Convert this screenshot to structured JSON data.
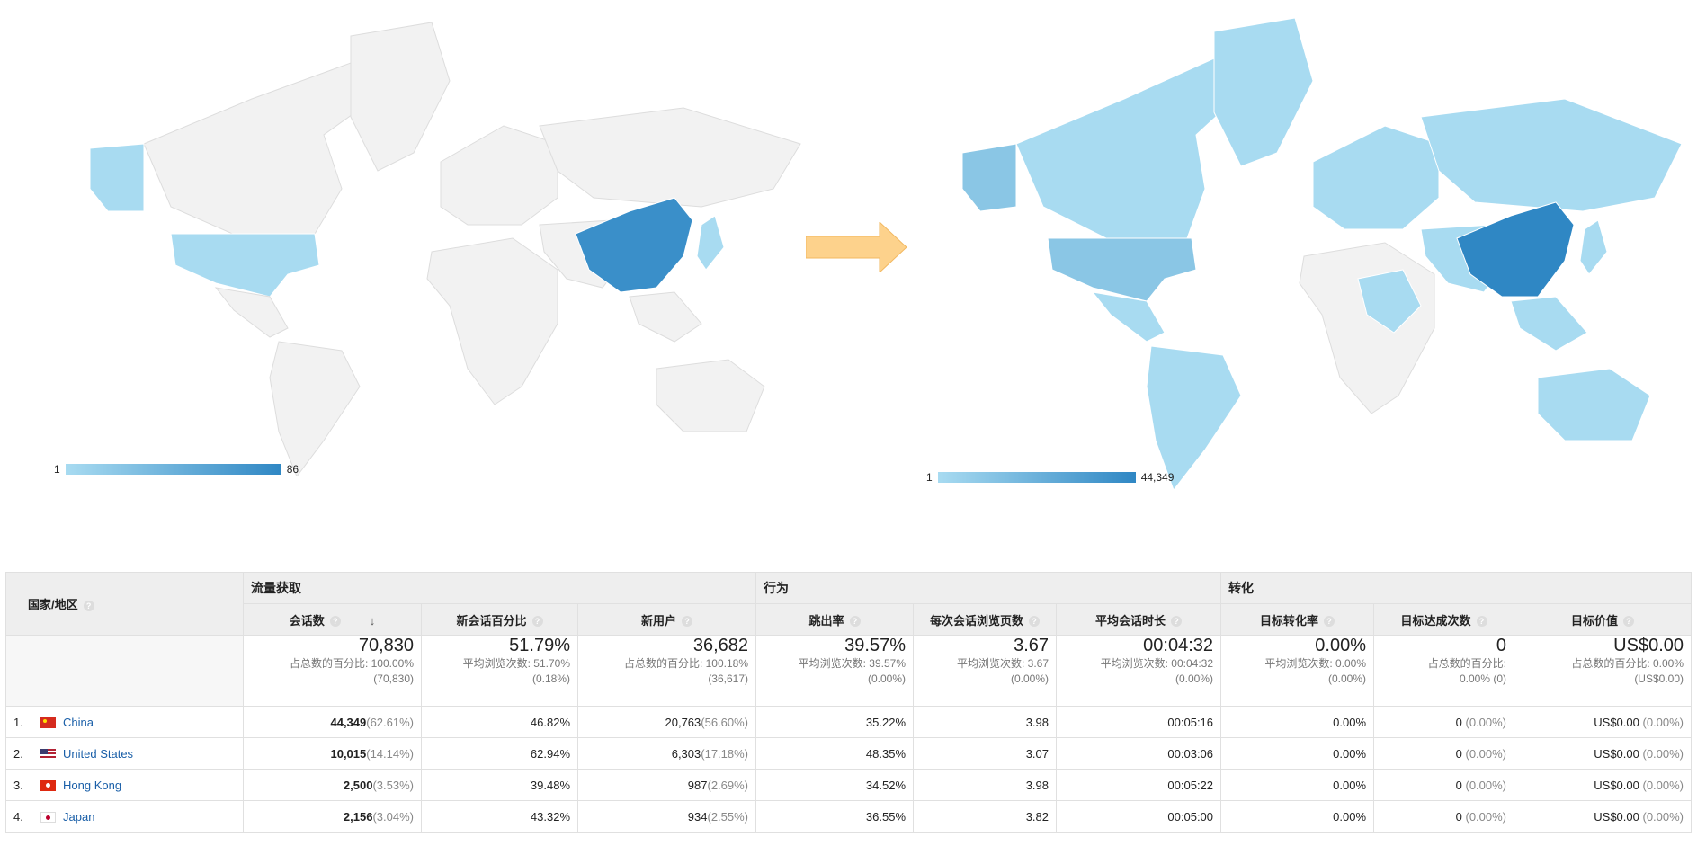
{
  "maps": {
    "left": {
      "legend_min": "1",
      "legend_max": "86"
    },
    "right": {
      "legend_min": "1",
      "legend_max": "44,349"
    }
  },
  "colors": {
    "low": "#a8dbf1",
    "high": "#2f87c4",
    "none": "#f2f2f2",
    "arrow": "#fdd28c"
  },
  "table": {
    "country_header": "国家/地区",
    "groups": {
      "acquisition": "流量获取",
      "behavior": "行为",
      "conversion": "转化"
    },
    "columns": {
      "sessions": "会话数",
      "new_sessions_pct": "新会话百分比",
      "new_users": "新用户",
      "bounce_rate": "跳出率",
      "pages_per_session": "每次会话浏览页数",
      "avg_duration": "平均会话时长",
      "goal_conv_rate": "目标转化率",
      "goal_completions": "目标达成次数",
      "goal_value": "目标价值"
    },
    "totals": {
      "sessions": {
        "big": "70,830",
        "l1": "占总数的百分比: 100.00%",
        "l2": "(70,830)"
      },
      "new_sessions_pct": {
        "big": "51.79%",
        "l1": "平均浏览次数: 51.70%",
        "l2": "(0.18%)"
      },
      "new_users": {
        "big": "36,682",
        "l1": "占总数的百分比: 100.18%",
        "l2": "(36,617)"
      },
      "bounce_rate": {
        "big": "39.57%",
        "l1": "平均浏览次数: 39.57%",
        "l2": "(0.00%)"
      },
      "pages_per_session": {
        "big": "3.67",
        "l1": "平均浏览次数: 3.67",
        "l2": "(0.00%)"
      },
      "avg_duration": {
        "big": "00:04:32",
        "l1": "平均浏览次数: 00:04:32",
        "l2": "(0.00%)"
      },
      "goal_conv_rate": {
        "big": "0.00%",
        "l1": "平均浏览次数: 0.00%",
        "l2": "(0.00%)"
      },
      "goal_completions": {
        "big": "0",
        "l1": "占总数的百分比:",
        "l2": "0.00% (0)"
      },
      "goal_value": {
        "big": "US$0.00",
        "l1": "占总数的百分比: 0.00%",
        "l2": "(US$0.00)"
      }
    },
    "rows": [
      {
        "num": "1.",
        "flag": "cn",
        "country": "China",
        "sessions": "44,349",
        "sessions_pct": "(62.61%)",
        "new_sessions_pct": "46.82%",
        "new_users": "20,763",
        "new_users_pct": "(56.60%)",
        "bounce_rate": "35.22%",
        "pages_per_session": "3.98",
        "avg_duration": "00:05:16",
        "goal_conv_rate": "0.00%",
        "goal_completions": "0",
        "goal_completions_pct": "(0.00%)",
        "goal_value": "US$0.00",
        "goal_value_pct": "(0.00%)"
      },
      {
        "num": "2.",
        "flag": "us",
        "country": "United States",
        "sessions": "10,015",
        "sessions_pct": "(14.14%)",
        "new_sessions_pct": "62.94%",
        "new_users": "6,303",
        "new_users_pct": "(17.18%)",
        "bounce_rate": "48.35%",
        "pages_per_session": "3.07",
        "avg_duration": "00:03:06",
        "goal_conv_rate": "0.00%",
        "goal_completions": "0",
        "goal_completions_pct": "(0.00%)",
        "goal_value": "US$0.00",
        "goal_value_pct": "(0.00%)"
      },
      {
        "num": "3.",
        "flag": "hk",
        "country": "Hong Kong",
        "sessions": "2,500",
        "sessions_pct": "(3.53%)",
        "new_sessions_pct": "39.48%",
        "new_users": "987",
        "new_users_pct": "(2.69%)",
        "bounce_rate": "34.52%",
        "pages_per_session": "3.98",
        "avg_duration": "00:05:22",
        "goal_conv_rate": "0.00%",
        "goal_completions": "0",
        "goal_completions_pct": "(0.00%)",
        "goal_value": "US$0.00",
        "goal_value_pct": "(0.00%)"
      },
      {
        "num": "4.",
        "flag": "jp",
        "country": "Japan",
        "sessions": "2,156",
        "sessions_pct": "(3.04%)",
        "new_sessions_pct": "43.32%",
        "new_users": "934",
        "new_users_pct": "(2.55%)",
        "bounce_rate": "36.55%",
        "pages_per_session": "3.82",
        "avg_duration": "00:05:00",
        "goal_conv_rate": "0.00%",
        "goal_completions": "0",
        "goal_completions_pct": "(0.00%)",
        "goal_value": "US$0.00",
        "goal_value_pct": "(0.00%)"
      }
    ]
  }
}
